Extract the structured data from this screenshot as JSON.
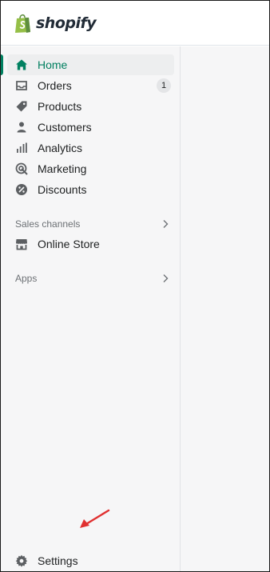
{
  "brand": {
    "name": "shopify",
    "logo_icon": "shopify-bag-icon",
    "color": "#95bf47"
  },
  "accent_color": "#008060",
  "nav": {
    "items": [
      {
        "label": "Home",
        "icon": "home-icon",
        "active": true
      },
      {
        "label": "Orders",
        "icon": "orders-icon",
        "badge": "1"
      },
      {
        "label": "Products",
        "icon": "tag-icon"
      },
      {
        "label": "Customers",
        "icon": "person-icon"
      },
      {
        "label": "Analytics",
        "icon": "bar-chart-icon"
      },
      {
        "label": "Marketing",
        "icon": "target-icon"
      },
      {
        "label": "Discounts",
        "icon": "discount-icon"
      }
    ],
    "sales_channels": {
      "label": "Sales channels",
      "icon": "chevron-right-icon"
    },
    "online_store": {
      "label": "Online Store",
      "icon": "storefront-icon"
    },
    "apps": {
      "label": "Apps",
      "icon": "chevron-right-icon"
    },
    "settings": {
      "label": "Settings",
      "icon": "gear-icon"
    }
  },
  "annotation": {
    "icon": "red-arrow-icon",
    "color": "#e03030"
  }
}
